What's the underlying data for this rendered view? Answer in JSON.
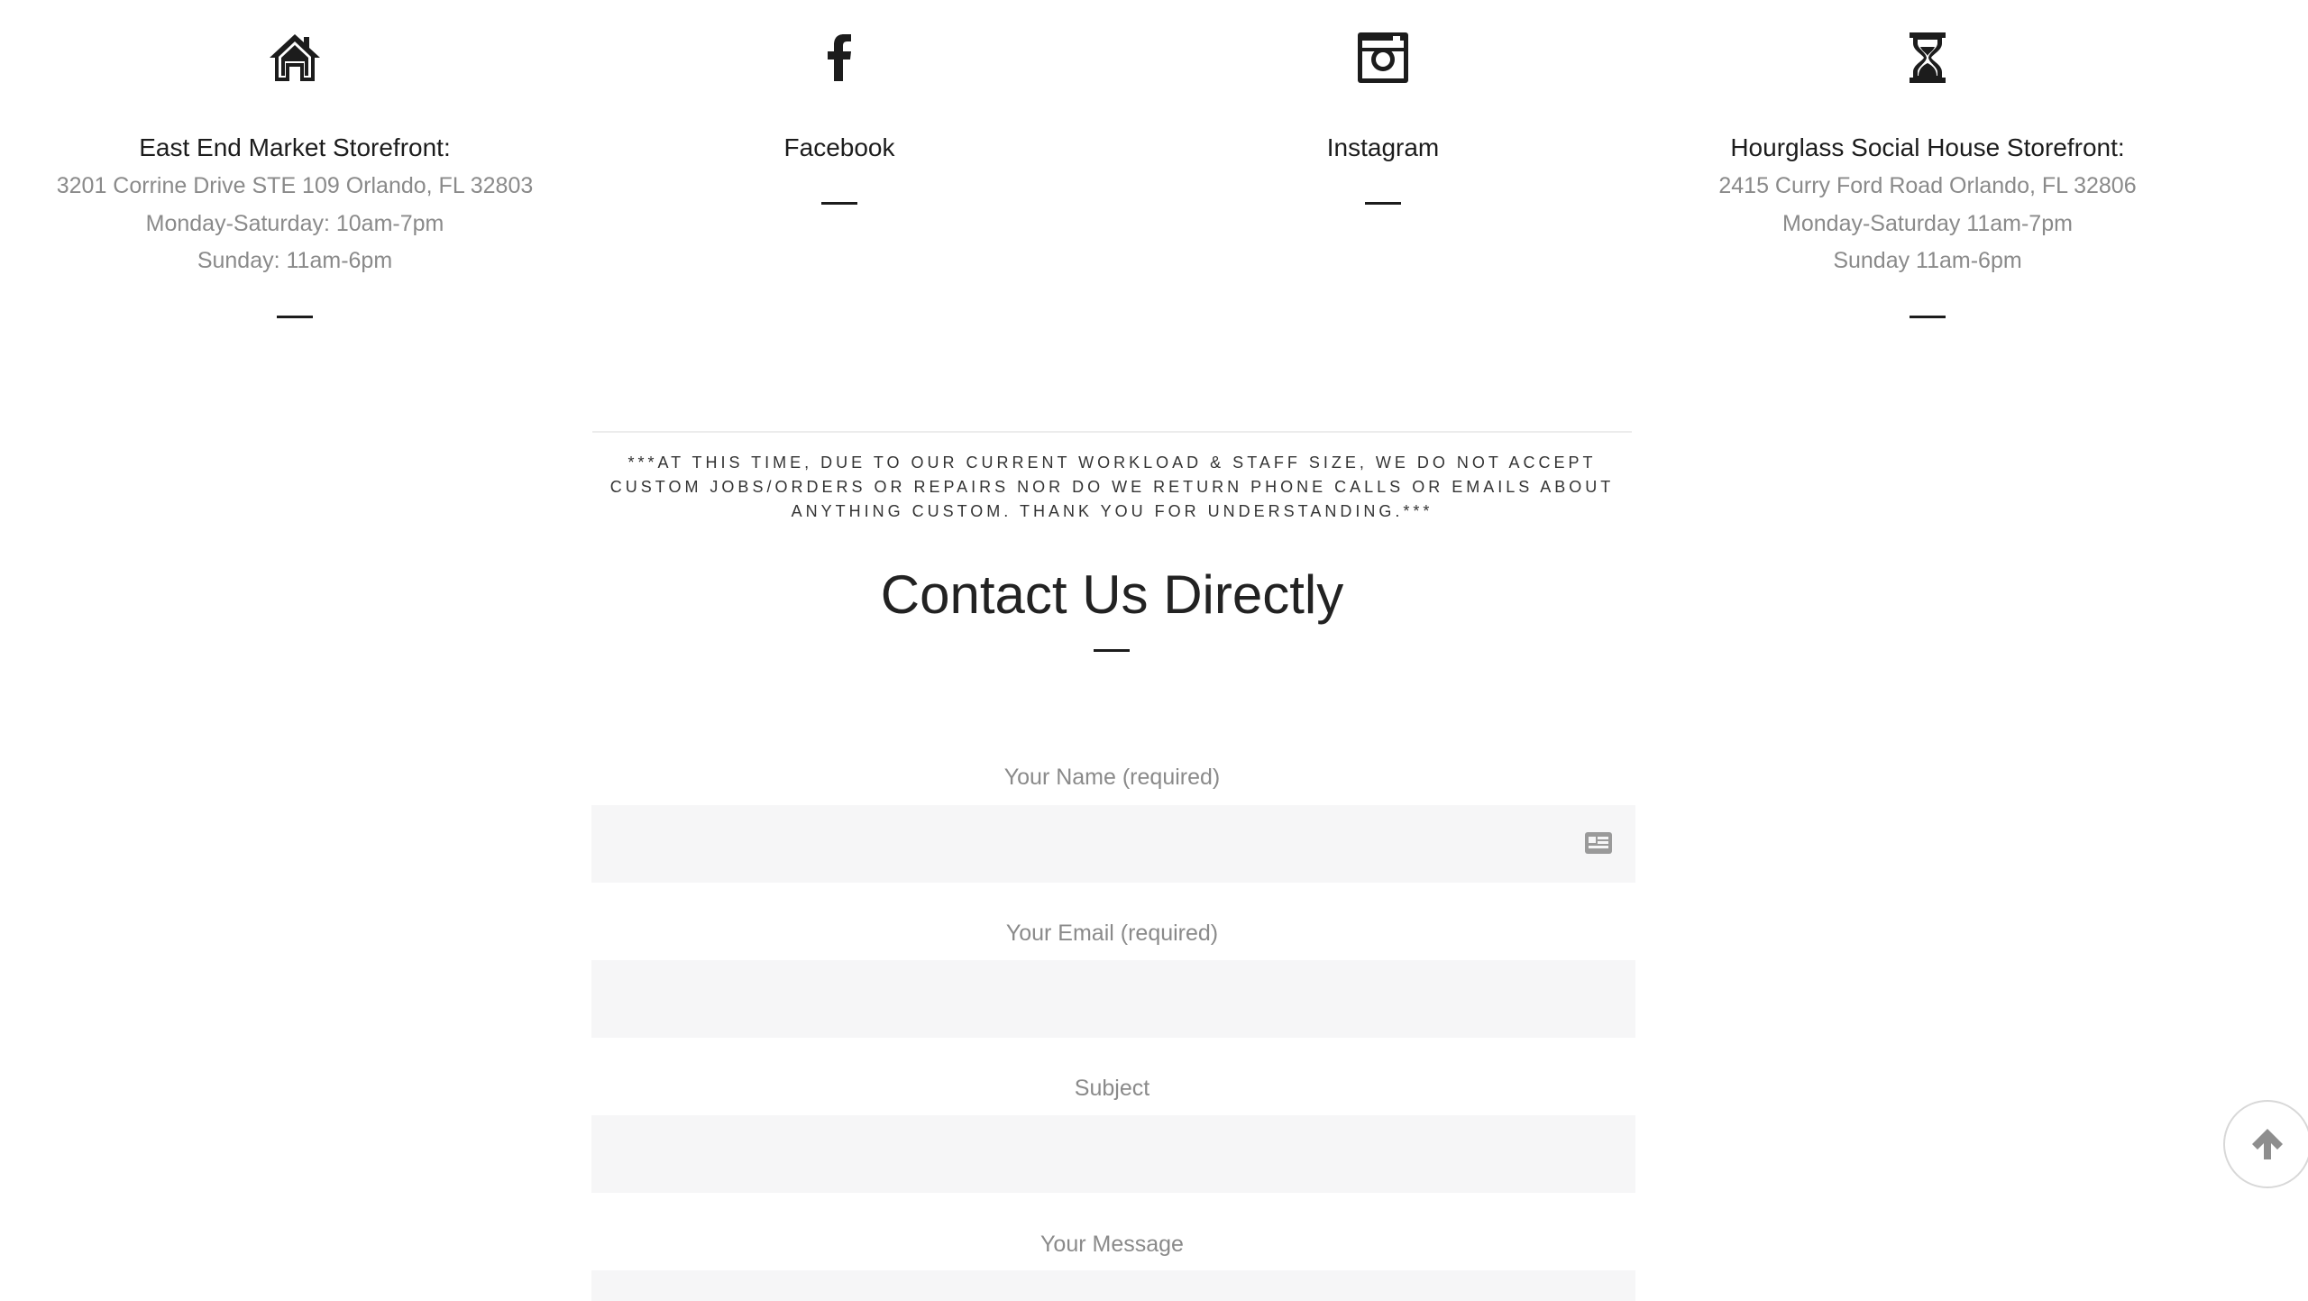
{
  "locations": [
    {
      "icon": "home-icon",
      "title": "East End Market Storefront:",
      "lines": [
        "3201 Corrine Drive STE 109 Orlando, FL 32803",
        "Monday-Saturday: 10am-7pm",
        "Sunday: 11am-6pm"
      ]
    },
    {
      "icon": "facebook-icon",
      "title": "Facebook",
      "lines": []
    },
    {
      "icon": "instagram-icon",
      "title": "Instagram",
      "lines": []
    },
    {
      "icon": "hourglass-icon",
      "title": "Hourglass Social House Storefront:",
      "lines": [
        "2415 Curry Ford Road Orlando, FL 32806",
        "Monday-Saturday 11am-7pm",
        "Sunday 11am-6pm"
      ]
    }
  ],
  "notice": "***AT THIS TIME, DUE TO OUR CURRENT WORKLOAD & STAFF SIZE, WE DO NOT ACCEPT CUSTOM JOBS/ORDERS OR REPAIRS NOR DO WE RETURN PHONE CALLS OR EMAILS ABOUT ANYTHING CUSTOM. THANK YOU FOR UNDERSTANDING.***",
  "contact": {
    "title": "Contact Us Directly",
    "fields": [
      {
        "label": "Your Name (required)",
        "value": ""
      },
      {
        "label": "Your Email (required)",
        "value": ""
      },
      {
        "label": "Subject",
        "value": ""
      },
      {
        "label": "Your Message",
        "value": ""
      }
    ]
  },
  "scroll_top_icon": "arrow-up-icon"
}
